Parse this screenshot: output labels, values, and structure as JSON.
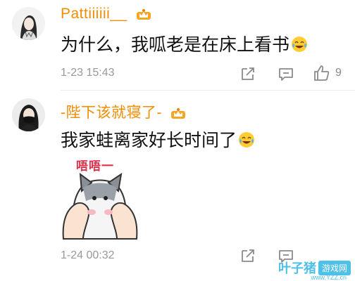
{
  "comments": [
    {
      "username": "Pattiiiiii__",
      "text": "为什么，我呱老是在床上看书",
      "time": "1-23 15:43",
      "likes": "9",
      "badge_icon": "vip-crown-icon",
      "emoji_icon": "laugh-cry-emoji-icon"
    },
    {
      "username": "-陛下该就寝了-",
      "text": "我家蛙离家好长时间了",
      "time": "1-24 00:32",
      "badge_icon": "vip-crown-icon",
      "emoji_icon": "laugh-cry-emoji-icon",
      "sticker_text": "唔唔一"
    }
  ],
  "watermark": {
    "main": "叶子猪",
    "badge": "游戏网",
    "url": "www.YZZ.cn"
  },
  "colors": {
    "username": "#f28c00",
    "meta": "#999999",
    "watermark": "#4fc1e9"
  }
}
